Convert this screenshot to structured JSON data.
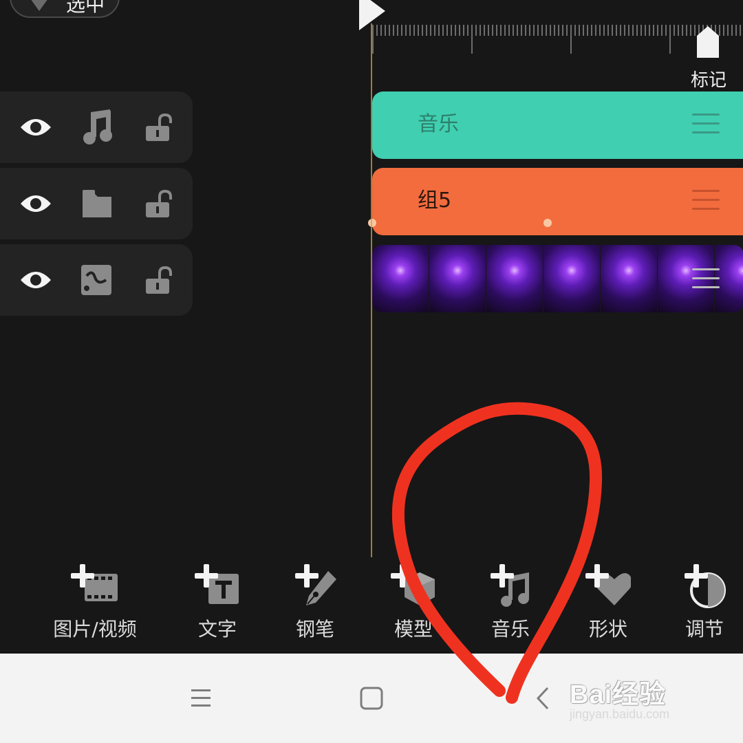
{
  "top_bar": {
    "pill_label": "选中"
  },
  "marker": {
    "label": "标记"
  },
  "layers": [
    {
      "type_icon": "music-note-icon"
    },
    {
      "type_icon": "folder-icon"
    },
    {
      "type_icon": "path-icon"
    }
  ],
  "tracks": {
    "music": {
      "label": "音乐",
      "color": "#40cfb1"
    },
    "group": {
      "label": "组5",
      "color": "#f26c3e"
    },
    "video": {
      "frames": 7
    }
  },
  "toolbar": {
    "items": [
      {
        "label": "图片/视频",
        "icon": "add-media-icon"
      },
      {
        "label": "文字",
        "icon": "add-text-icon"
      },
      {
        "label": "钢笔",
        "icon": "add-pen-icon"
      },
      {
        "label": "模型",
        "icon": "add-model-icon"
      },
      {
        "label": "音乐",
        "icon": "add-music-icon"
      },
      {
        "label": "形状",
        "icon": "add-shape-icon"
      },
      {
        "label": "调节",
        "icon": "add-adjust-icon"
      }
    ]
  },
  "navbar": {
    "buttons": [
      "menu-icon",
      "home-icon",
      "back-icon"
    ]
  },
  "annotation": {
    "color": "#ef3220"
  },
  "watermark": {
    "brand": "Bai经验",
    "url": "jingyan.baidu.com"
  }
}
